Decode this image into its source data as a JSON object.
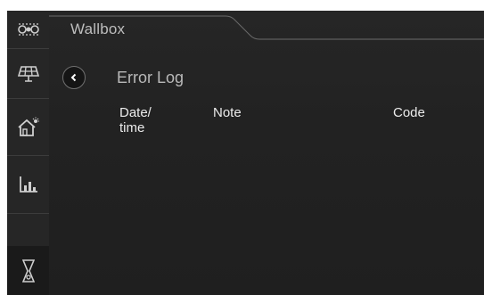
{
  "tab": {
    "title": "Wallbox"
  },
  "nav": {
    "items": [
      {
        "icon": "energy-flow-icon"
      },
      {
        "icon": "solar-panel-icon"
      },
      {
        "icon": "smart-home-icon"
      },
      {
        "icon": "statistics-icon"
      },
      {
        "icon": "hourglass-icon"
      }
    ]
  },
  "page": {
    "title": "Error Log"
  },
  "table": {
    "columns": [
      "Date/\ntime",
      "Note",
      "Code"
    ],
    "rows": []
  },
  "colors": {
    "background": "#1f1f1f",
    "text": "#ececec",
    "muted_text": "#bdbdbd",
    "divider": "#4a4a4a"
  }
}
